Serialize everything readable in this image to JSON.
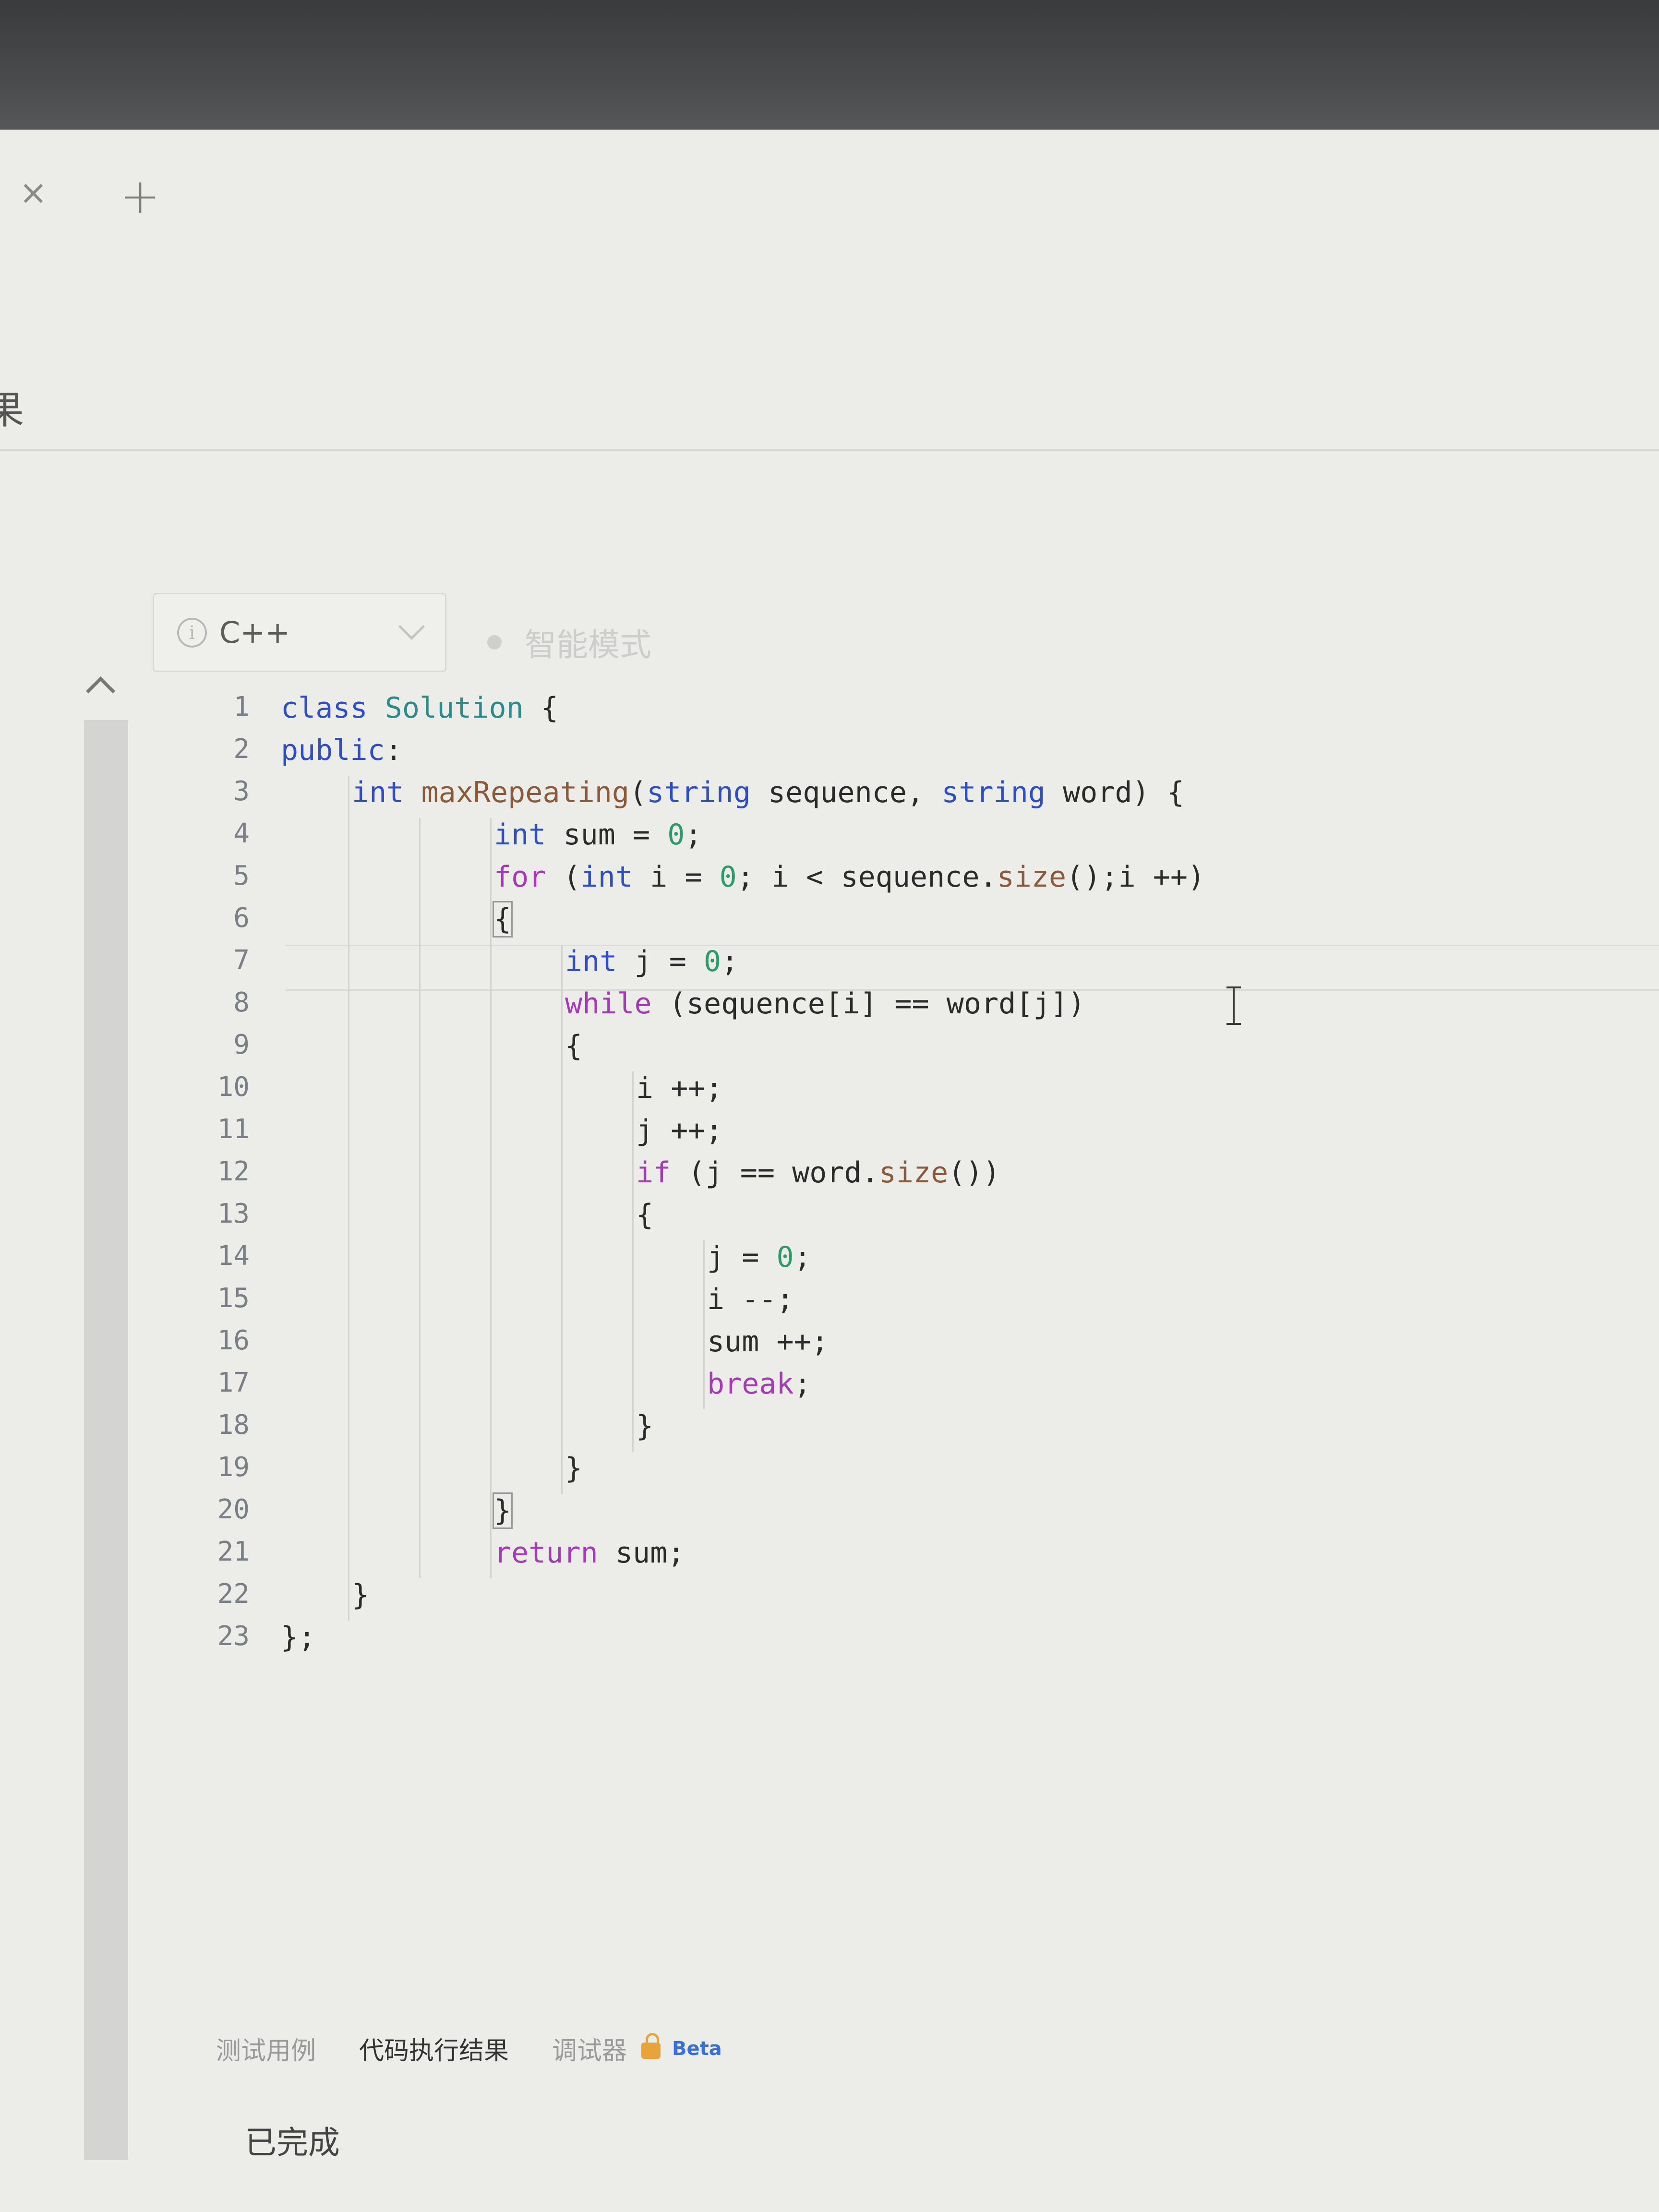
{
  "browser": {
    "close_glyph": "×",
    "add_glyph": "+",
    "partial_char": "果"
  },
  "toolbar": {
    "language": "C++",
    "info_glyph": "i",
    "smart_mode": "智能模式"
  },
  "editor": {
    "lines": [
      {
        "n": "1",
        "indent": 0
      },
      {
        "n": "2",
        "indent": 0
      },
      {
        "n": "3",
        "indent": 1
      },
      {
        "n": "4",
        "indent": 3
      },
      {
        "n": "5",
        "indent": 3
      },
      {
        "n": "6",
        "indent": 3
      },
      {
        "n": "7",
        "indent": 4
      },
      {
        "n": "8",
        "indent": 4
      },
      {
        "n": "9",
        "indent": 4
      },
      {
        "n": "10",
        "indent": 5
      },
      {
        "n": "11",
        "indent": 5
      },
      {
        "n": "12",
        "indent": 5
      },
      {
        "n": "13",
        "indent": 5
      },
      {
        "n": "14",
        "indent": 6
      },
      {
        "n": "15",
        "indent": 6
      },
      {
        "n": "16",
        "indent": 6
      },
      {
        "n": "17",
        "indent": 6
      },
      {
        "n": "18",
        "indent": 5
      },
      {
        "n": "19",
        "indent": 4
      },
      {
        "n": "20",
        "indent": 3
      },
      {
        "n": "21",
        "indent": 3
      },
      {
        "n": "22",
        "indent": 1
      },
      {
        "n": "23",
        "indent": 0
      }
    ],
    "code": [
      "class Solution {",
      "public:",
      "int maxRepeating(string sequence, string word) {",
      "int sum = 0;",
      "for (int i = 0; i < sequence.size();i ++)",
      "{",
      "int j = 0;",
      "while (sequence[i] == word[j])",
      "{",
      "i ++;",
      "j ++;",
      "if (j == word.size())",
      "{",
      "j = 0;",
      "i --;",
      "sum ++;",
      "break;",
      "}",
      "}",
      "}",
      "return sum;",
      "}",
      "};"
    ]
  },
  "bottom_panel": {
    "tabs": [
      "测试用例",
      "代码执行结果",
      "调试器"
    ],
    "beta_label": "Beta",
    "status": "已完成"
  }
}
